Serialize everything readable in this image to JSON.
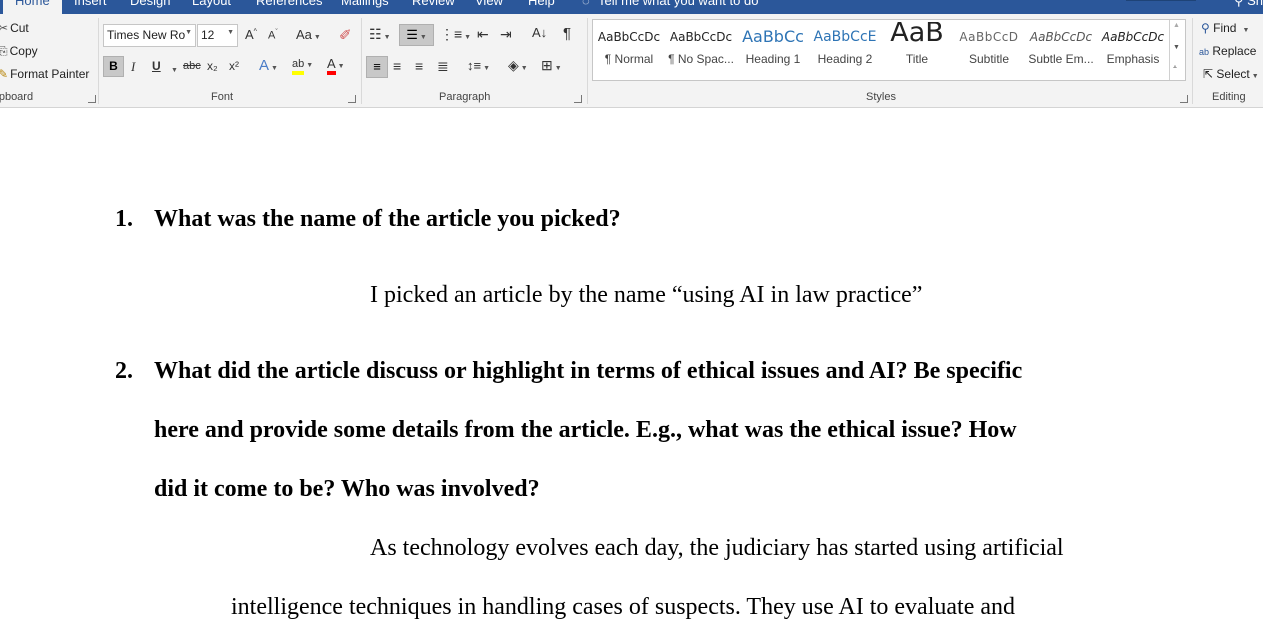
{
  "tabs": [
    "Home",
    "Insert",
    "Design",
    "Layout",
    "References",
    "Mailings",
    "Review",
    "View",
    "Help",
    "Tell me what you want to do"
  ],
  "share_label": "Share",
  "clipboard": {
    "cut": "Cut",
    "copy": "Copy",
    "format_painter": "Format Painter",
    "group_label": "Clipboard"
  },
  "font": {
    "family": "Times New Ro",
    "size": "12",
    "group_label": "Font",
    "change_case": "Aa",
    "bold": "B",
    "italic": "I",
    "underline": "U",
    "strike": "abc",
    "subscript": "x₂",
    "superscript": "x²",
    "grow": "A",
    "shrink": "A"
  },
  "paragraph": {
    "group_label": "Paragraph"
  },
  "styles": {
    "group_label": "Styles",
    "items": [
      {
        "sample": "AaBbCcDc",
        "name": "¶ Normal"
      },
      {
        "sample": "AaBbCcDc",
        "name": "¶ No Spac..."
      },
      {
        "sample": "AaBbCc",
        "name": "Heading 1"
      },
      {
        "sample": "AaBbCcE",
        "name": "Heading 2"
      },
      {
        "sample": "AaB",
        "name": "Title"
      },
      {
        "sample": "AaBbCcD",
        "name": "Subtitle"
      },
      {
        "sample": "AaBbCcDc",
        "name": "Subtle Em..."
      },
      {
        "sample": "AaBbCcDc",
        "name": "Emphasis"
      }
    ]
  },
  "editing": {
    "find": "Find",
    "replace": "Replace",
    "select": "Select",
    "group_label": "Editing"
  },
  "colors": {
    "ribbon_blue": "#2b579a",
    "highlight": "#ffff00",
    "font_color": "#ff0000",
    "heading_blue": "#2e74b5"
  },
  "document": {
    "q1_num": "1.",
    "q1": "What was the name of the article you picked?",
    "a1": "I picked an article by the name “using AI in law practice”",
    "q2_num": "2.",
    "q2_line1": "What did the article discuss or highlight in terms of ethical issues and AI? Be specific",
    "q2_line2": "here and provide some details from the article. E.g., what was the ethical issue? How",
    "q2_line3": "did it come to be? Who was involved?",
    "a2_line1": "As technology evolves each day, the judiciary has started using artificial",
    "a2_line2": "intelligence techniques in handling cases of suspects. They use AI to evaluate and"
  }
}
